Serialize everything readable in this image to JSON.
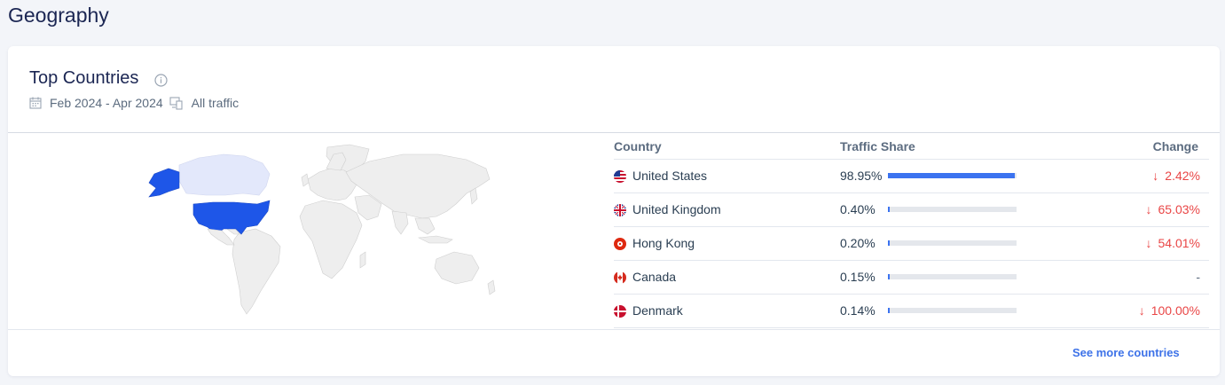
{
  "section": {
    "title": "Geography"
  },
  "card": {
    "title": "Top Countries",
    "date_range": "Feb 2024 - Apr 2024",
    "traffic_type": "All traffic"
  },
  "table": {
    "headers": {
      "country": "Country",
      "share": "Traffic Share",
      "change": "Change"
    },
    "rows": [
      {
        "country": "United States",
        "share": "98.95%",
        "share_value": 98.95,
        "change": "2.42%",
        "direction": "down",
        "arrow": "↓",
        "flag_icon": "us-flag-icon"
      },
      {
        "country": "United Kingdom",
        "share": "0.40%",
        "share_value": 0.4,
        "change": "65.03%",
        "direction": "down",
        "arrow": "↓",
        "flag_icon": "uk-flag-icon"
      },
      {
        "country": "Hong Kong",
        "share": "0.20%",
        "share_value": 0.2,
        "change": "54.01%",
        "direction": "down",
        "arrow": "↓",
        "flag_icon": "hk-flag-icon"
      },
      {
        "country": "Canada",
        "share": "0.15%",
        "share_value": 0.15,
        "change": "-",
        "direction": "none",
        "arrow": "",
        "flag_icon": "ca-flag-icon"
      },
      {
        "country": "Denmark",
        "share": "0.14%",
        "share_value": 0.14,
        "change": "100.00%",
        "direction": "down",
        "arrow": "↓",
        "flag_icon": "dk-flag-icon"
      }
    ]
  },
  "colors": {
    "bar_fill": "#3b73f0",
    "bar_track": "#e4e7ec",
    "negative_change": "#e94646",
    "map_highlight": "#1e56e8",
    "map_light": "#e3e8fb",
    "map_default": "#eeeeee"
  },
  "links": {
    "see_more": "See more countries"
  }
}
